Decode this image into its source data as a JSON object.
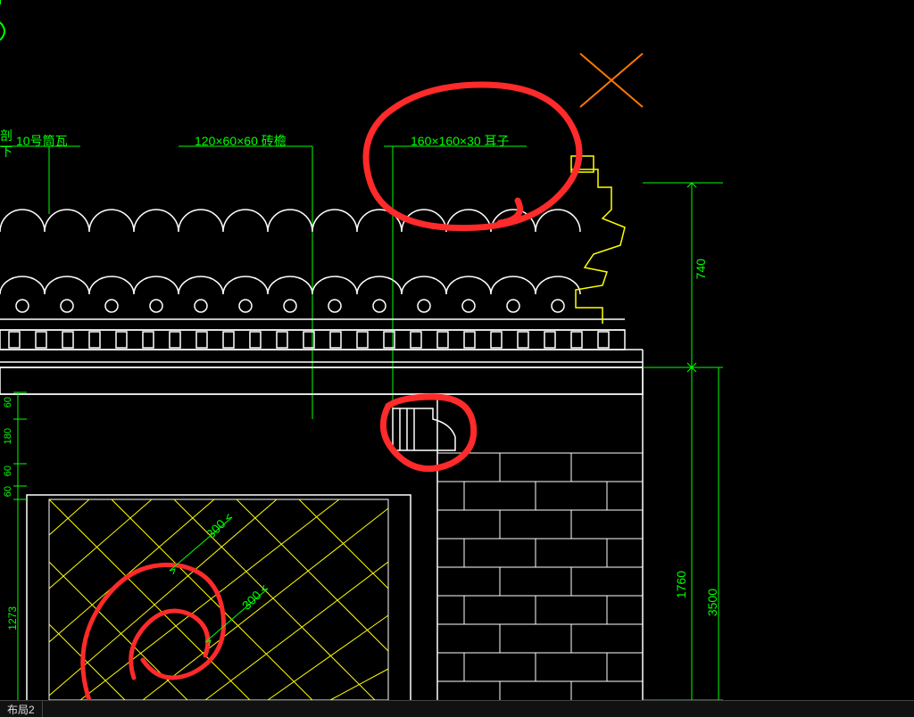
{
  "labels": {
    "tile": "10号筒瓦",
    "brickEave": "120×60×60 砖檐",
    "ear": "160×160×30 耳子",
    "left_a": "剖",
    "left_b": "下"
  },
  "dimensions": {
    "right_top": "740",
    "right_bottom1": "1760",
    "right_bottom2": "3500",
    "diag1": "300",
    "diag2": "300",
    "left_a": "60",
    "left_b": "180",
    "left_c": "60",
    "left_d": "60",
    "left_e": "1273"
  },
  "tabs": {
    "layout2": "布局2"
  },
  "colors": {
    "line": "#ffffff",
    "green": "#00ff00",
    "yellow": "#ffff00",
    "orange": "#ff6600",
    "red": "#ff2a2a"
  }
}
